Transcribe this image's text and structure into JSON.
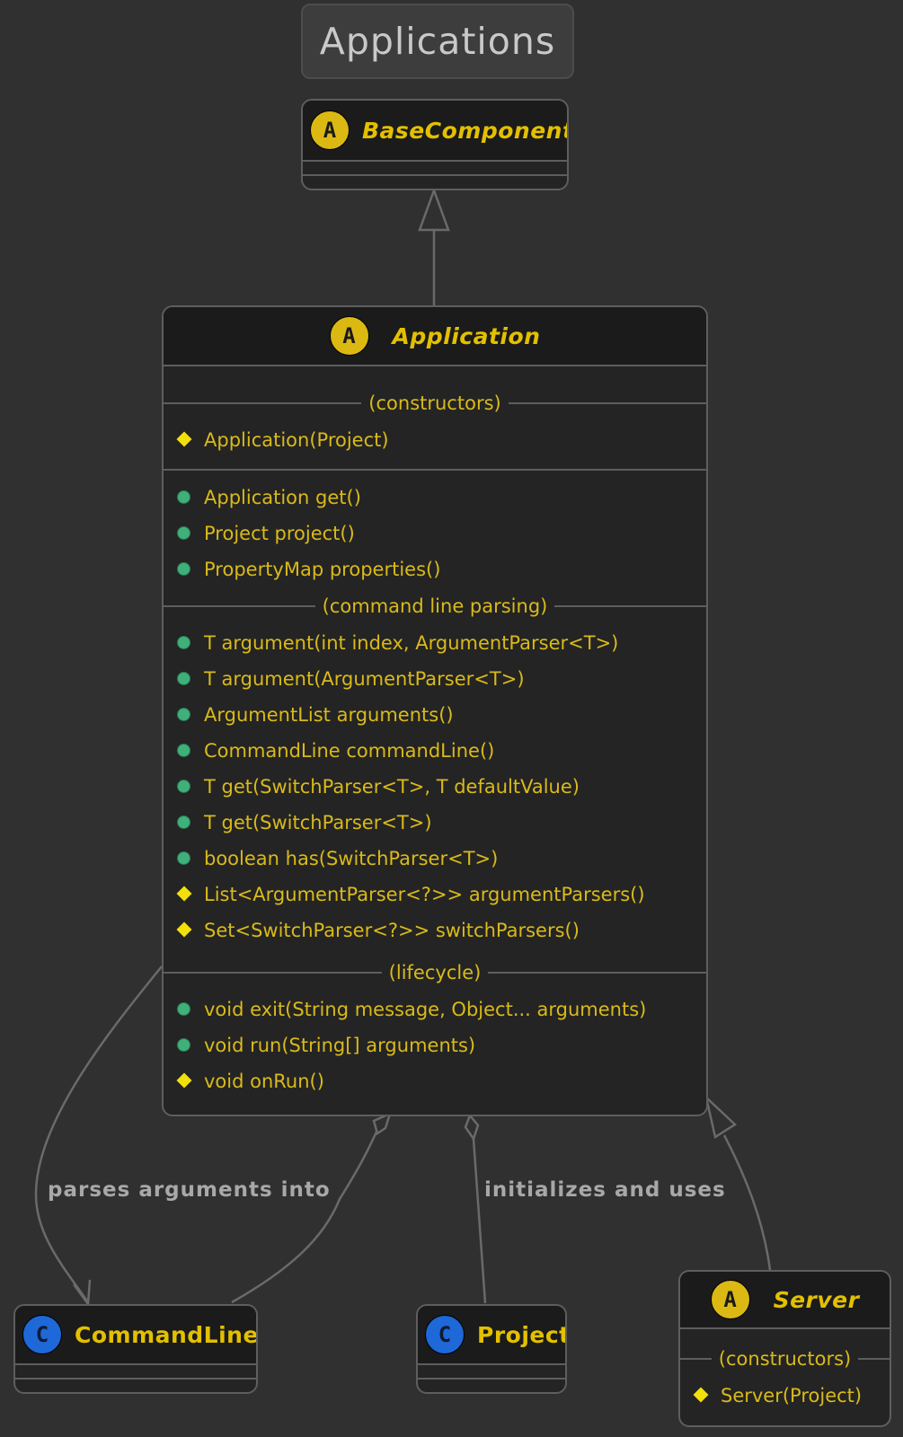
{
  "package_title": "Applications",
  "classes": {
    "base_component": {
      "stereotype": "A",
      "name": "BaseComponent"
    },
    "application": {
      "stereotype": "A",
      "name": "Application",
      "sections": {
        "constructors": "(constructors)",
        "command_line_parsing": "(command line parsing)",
        "lifecycle": "(lifecycle)"
      },
      "constructors": [
        {
          "text": "Application(Project)",
          "visibility": "protected"
        }
      ],
      "accessors": [
        {
          "text": "Application get()",
          "visibility": "public"
        },
        {
          "text": "Project project()",
          "visibility": "public"
        },
        {
          "text": "PropertyMap properties()",
          "visibility": "public"
        }
      ],
      "parsing": [
        {
          "text": "T argument(int index, ArgumentParser<T>)",
          "visibility": "public"
        },
        {
          "text": "T argument(ArgumentParser<T>)",
          "visibility": "public"
        },
        {
          "text": "ArgumentList arguments()",
          "visibility": "public"
        },
        {
          "text": "CommandLine commandLine()",
          "visibility": "public"
        },
        {
          "text": "T get(SwitchParser<T>, T defaultValue)",
          "visibility": "public"
        },
        {
          "text": "T get(SwitchParser<T>)",
          "visibility": "public"
        },
        {
          "text": "boolean has(SwitchParser<T>)",
          "visibility": "public"
        },
        {
          "text": "List<ArgumentParser<?>> argumentParsers()",
          "visibility": "protected"
        },
        {
          "text": "Set<SwitchParser<?>> switchParsers()",
          "visibility": "protected"
        }
      ],
      "lifecycle": [
        {
          "text": "void exit(String message, Object... arguments)",
          "visibility": "public"
        },
        {
          "text": "void run(String[] arguments)",
          "visibility": "public"
        },
        {
          "text": "void onRun()",
          "visibility": "protected"
        }
      ]
    },
    "command_line": {
      "stereotype": "C",
      "name": "CommandLine"
    },
    "project": {
      "stereotype": "C",
      "name": "Project"
    },
    "server": {
      "stereotype": "A",
      "name": "Server",
      "section": "(constructors)",
      "constructors": [
        {
          "text": "Server(Project)",
          "visibility": "protected"
        }
      ]
    }
  },
  "edge_labels": {
    "parses": "parses arguments into",
    "initializes": "initializes and uses"
  },
  "colors": {
    "background": "#303030",
    "class_fill": "#242424",
    "header_fill": "#1b1b1b",
    "border": "#5e5e5e",
    "text": "#d9ba1a",
    "abstract_badge": "#dbb912",
    "class_badge": "#1e68d8",
    "public_marker": "#3fb07a",
    "protected_marker": "#f2e00c",
    "edge": "#6a6a6a"
  }
}
